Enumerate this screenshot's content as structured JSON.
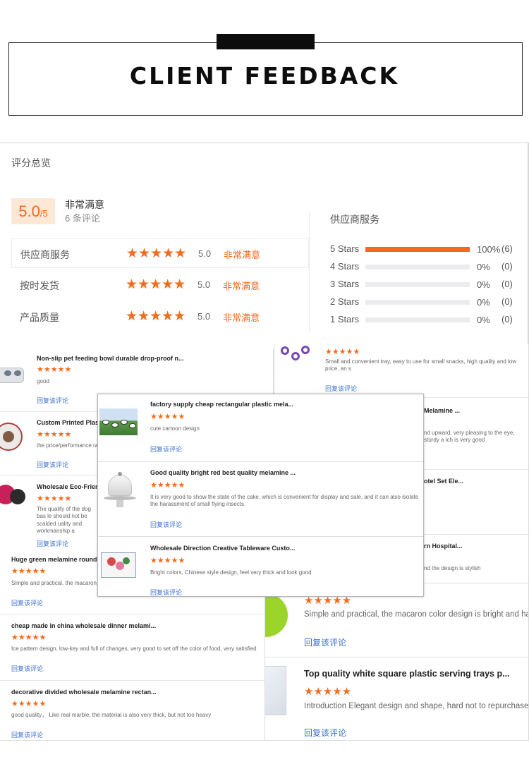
{
  "header": {
    "title": "CLIENT FEEDBACK"
  },
  "summary": {
    "panel_title": "评分总览",
    "score": "5.0",
    "score_max": "/5",
    "overall_label": "非常满意",
    "review_count": "6 条评论",
    "dimensions": [
      {
        "label": "供应商服务",
        "stars": "★★★★★",
        "score": "5.0",
        "text": "非常满意"
      },
      {
        "label": "按时发货",
        "stars": "★★★★★",
        "score": "5.0",
        "text": "非常满意"
      },
      {
        "label": "产品质量",
        "stars": "★★★★★",
        "score": "5.0",
        "text": "非常满意"
      }
    ],
    "distribution_title": "供应商服务",
    "distribution": [
      {
        "label": "5 Stars",
        "fraction": 1.0,
        "pct": "100%",
        "count": "(6)"
      },
      {
        "label": "4 Stars",
        "fraction": 0,
        "pct": "0%",
        "count": "(0)"
      },
      {
        "label": "3 Stars",
        "fraction": 0,
        "pct": "0%",
        "count": "(0)"
      },
      {
        "label": "2 Stars",
        "fraction": 0,
        "pct": "0%",
        "count": "(0)"
      },
      {
        "label": "1 Stars",
        "fraction": 0,
        "pct": "0%",
        "count": "(0)"
      }
    ],
    "accent_color": "#f26b1d"
  },
  "reply_label": "回复该评论",
  "stars": "★★★★★",
  "left_card": {
    "reviews": [
      {
        "title": "Non-slip pet feeding bowl durable drop-proof n...",
        "body": "good"
      },
      {
        "title": "Custom Printed Plasti",
        "body": "the price/performance ra"
      },
      {
        "title": "Wholesale Eco-Friendl",
        "body": "The quality of the dog bas le should not be scalded uality and workmanship a"
      }
    ]
  },
  "right_card": {
    "reviews": [
      {
        "title": "",
        "body": "Small and convenient tray, easy to use for small snacks, high quality and low price, an s"
      },
      {
        "title": "Melamine ...",
        "body": "nd upward, very pleasing to the eye, sturdy a ich is very good"
      },
      {
        "title": "otel Set Ele...",
        "body": ""
      },
      {
        "title": "rn Hospital...",
        "body": "nd the design is stylish"
      }
    ]
  },
  "overlay_card": {
    "reviews": [
      {
        "title": "factory supply cheap rectangular plastic mela...",
        "body": "cute cartoon design"
      },
      {
        "title": "Good quality bright red best quality melamine ...",
        "body": "It is very good to show the state of the cake, which is convenient for display and sale, and it can also isolate the harassment of small flying insects."
      },
      {
        "title": "Wholesale Direction Creative Tableware Custo...",
        "body": "Bright colors, Chinese style design, feel very thick and look good"
      }
    ]
  },
  "bottom_left_card": {
    "reviews": [
      {
        "title": "Huge green melamine round s",
        "body": "Simple and practical, the macaron"
      },
      {
        "title": "cheap made in china wholesale dinner melami...",
        "body": "Ice pattern design, low-key and full of changes, very good to set off the color of food, very satisfied"
      },
      {
        "title": "decorative divided wholesale melamine rectan...",
        "body": "good quality， Like real marble, the material is also very thick, but not too heavy"
      }
    ]
  },
  "bottom_right_card": {
    "reviews": [
      {
        "title": "",
        "body": "Simple and practical, the macaron color design is bright and happy"
      },
      {
        "title": "Top quality white square plastic serving trays p...",
        "body": "Introduction Elegant design and shape, hard not to repurchase"
      }
    ]
  }
}
